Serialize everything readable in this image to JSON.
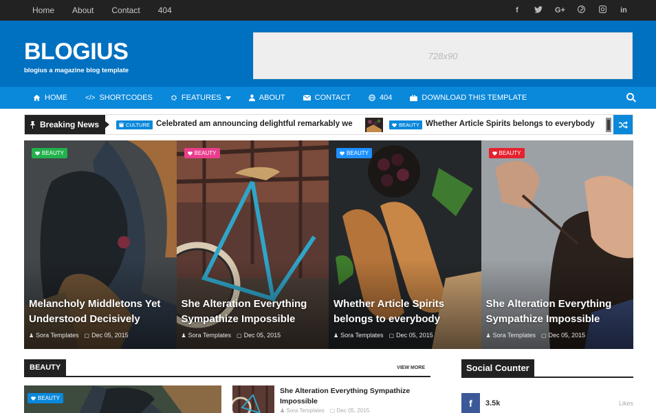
{
  "topbar": {
    "links": [
      "Home",
      "About",
      "Contact",
      "404"
    ],
    "social_icons": [
      "facebook-icon",
      "twitter-icon",
      "google-plus-icon",
      "pinterest-icon",
      "instagram-icon",
      "linkedin-icon"
    ],
    "social_glyphs": [
      "f",
      "t",
      "G+",
      "p",
      "◘",
      "in"
    ]
  },
  "header": {
    "logo": "BLOGIUS",
    "tagline": "blogius a magazine blog template",
    "ad_label": "728x90"
  },
  "nav": {
    "items": [
      {
        "label": "HOME",
        "icon": "home-icon",
        "glyph": "⌂"
      },
      {
        "label": "SHORTCODES",
        "icon": "code-icon",
        "glyph": "</>"
      },
      {
        "label": "FEATURES",
        "icon": "gear-icon",
        "glyph": "✲",
        "dropdown": true
      },
      {
        "label": "ABOUT",
        "icon": "user-icon",
        "glyph": "♟"
      },
      {
        "label": "CONTACT",
        "icon": "envelope-icon",
        "glyph": "✉"
      },
      {
        "label": "404",
        "icon": "globe-icon",
        "glyph": "◍"
      },
      {
        "label": "DOWNLOAD THIS TEMPLATE",
        "icon": "briefcase-icon",
        "glyph": "▤"
      }
    ]
  },
  "breaking": {
    "label": "Breaking News",
    "items": [
      {
        "tag": "CULTURE",
        "title": "Celebrated am announcing delightful remarkably we"
      },
      {
        "tag": "BEAUTY",
        "title": "Whether Article Spirits belongs to everybody"
      }
    ]
  },
  "featured": [
    {
      "tag": "BEAUTY",
      "tag_color": "#22b14c",
      "title": "Melancholy Middletons Yet Understood Decisively",
      "author": "Sora Templates",
      "date": "Dec 05, 2015"
    },
    {
      "tag": "BEAUTY",
      "tag_color": "#e83e8c",
      "title": "She Alteration Everything Sympathize Impossible",
      "author": "Sora Templates",
      "date": "Dec 05, 2015"
    },
    {
      "tag": "BEAUTY",
      "tag_color": "#1e90ff",
      "title": "Whether Article Spirits belongs to everybody",
      "author": "Sora Templates",
      "date": "Dec 05, 2015"
    },
    {
      "tag": "BEAUTY",
      "tag_color": "#e6212e",
      "title": "She Alteration Everything Sympathize Impossible",
      "author": "Sora Templates",
      "date": "Dec 05, 2015"
    }
  ],
  "beauty_section": {
    "title": "BEAUTY",
    "view_more": "VIEW MORE",
    "main_tag": "BEAUTY",
    "side_post": {
      "title": "She Alteration Everything Sympathize Impossible",
      "author": "Sora Templates",
      "date": "Dec 05, 2015"
    }
  },
  "social_counter": {
    "title": "Social Counter",
    "facebook": {
      "count": "3.5k",
      "unit": "Likes"
    }
  }
}
